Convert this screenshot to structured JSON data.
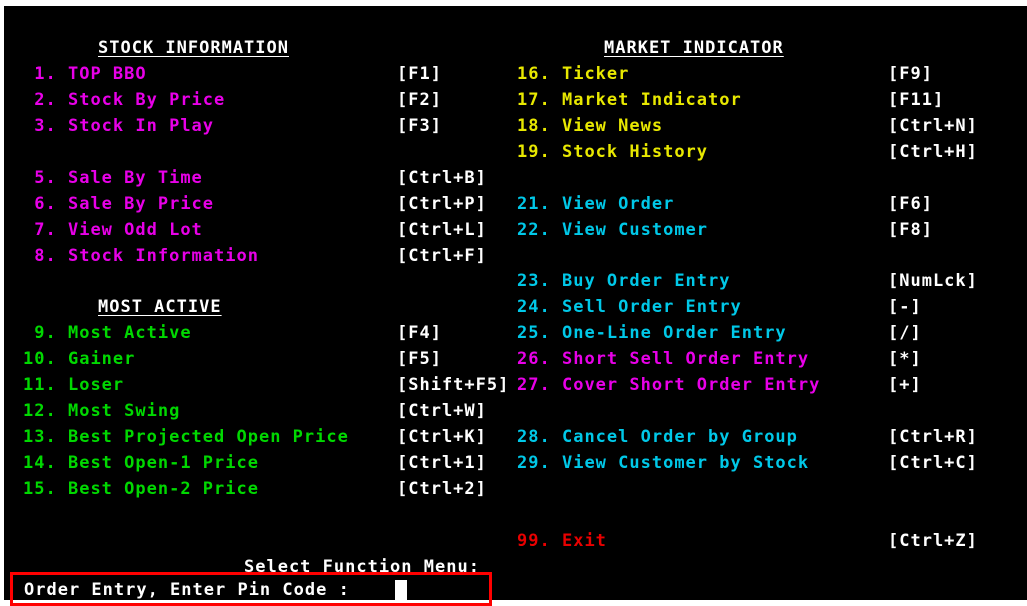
{
  "headers": {
    "stock_information": "STOCK INFORMATION",
    "market_indicator": "MARKET INDICATOR",
    "most_active": "MOST ACTIVE"
  },
  "left_items": [
    {
      "num": " 1.",
      "label": "TOP BBO",
      "key": "[F1]"
    },
    {
      "num": " 2.",
      "label": "Stock By Price",
      "key": "[F2]"
    },
    {
      "num": " 3.",
      "label": "Stock In Play",
      "key": "[F3]"
    },
    {
      "num": " 5.",
      "label": "Sale By Time",
      "key": "[Ctrl+B]"
    },
    {
      "num": " 6.",
      "label": "Sale By Price",
      "key": "[Ctrl+P]"
    },
    {
      "num": " 7.",
      "label": "View Odd Lot",
      "key": "[Ctrl+L]"
    },
    {
      "num": " 8.",
      "label": "Stock Information",
      "key": "[Ctrl+F]"
    },
    {
      "num": " 9.",
      "label": "Most Active",
      "key": "[F4]"
    },
    {
      "num": "10.",
      "label": "Gainer",
      "key": "[F5]"
    },
    {
      "num": "11.",
      "label": "Loser",
      "key": "[Shift+F5]"
    },
    {
      "num": "12.",
      "label": "Most Swing",
      "key": "[Ctrl+W]"
    },
    {
      "num": "13.",
      "label": "Best Projected Open Price",
      "key": "[Ctrl+K]"
    },
    {
      "num": "14.",
      "label": "Best Open-1 Price",
      "key": "[Ctrl+1]"
    },
    {
      "num": "15.",
      "label": "Best Open-2 Price",
      "key": "[Ctrl+2]"
    }
  ],
  "right_items": [
    {
      "num": "16.",
      "label": "Ticker",
      "key": "[F9]"
    },
    {
      "num": "17.",
      "label": "Market Indicator",
      "key": "[F11]"
    },
    {
      "num": "18.",
      "label": "View News",
      "key": "[Ctrl+N]"
    },
    {
      "num": "19.",
      "label": "Stock History",
      "key": "[Ctrl+H]"
    },
    {
      "num": "21.",
      "label": "View Order",
      "key": "[F6]"
    },
    {
      "num": "22.",
      "label": "View Customer",
      "key": "[F8]"
    },
    {
      "num": "23.",
      "label": "Buy Order Entry",
      "key": "[NumLck]"
    },
    {
      "num": "24.",
      "label": "Sell Order Entry",
      "key": "[-]"
    },
    {
      "num": "25.",
      "label": "One-Line Order Entry",
      "key": "[/]"
    },
    {
      "num": "26.",
      "label": "Short Sell Order Entry",
      "key": "[*]"
    },
    {
      "num": "27.",
      "label": "Cover Short Order Entry",
      "key": "[+]"
    },
    {
      "num": "28.",
      "label": "Cancel Order by Group",
      "key": "[Ctrl+R]"
    },
    {
      "num": "29.",
      "label": "View Customer by Stock",
      "key": "[Ctrl+C]"
    },
    {
      "num": "99.",
      "label": "Exit",
      "key": "[Ctrl+Z]"
    }
  ],
  "prompt": {
    "select_function": "Select Function Menu:",
    "pin_code": "Order Entry, Enter Pin Code :",
    "pin_value": ""
  },
  "colors": {
    "background": "#000000",
    "magenta": "#e800e8",
    "green": "#00d800",
    "yellow": "#e8e800",
    "cyan": "#00c8e8",
    "red": "#e80000",
    "highlight_border": "#ff0000"
  }
}
